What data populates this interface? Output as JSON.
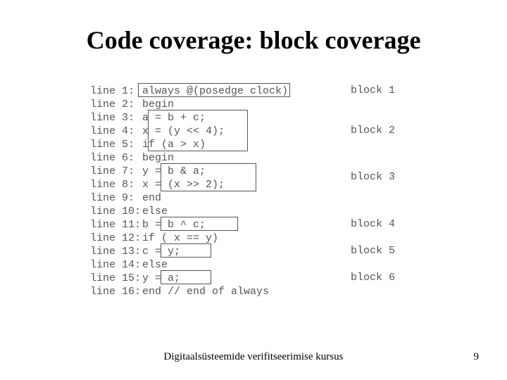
{
  "title": "Code coverage: block coverage",
  "lines": [
    {
      "n": "line 1:",
      "code": "always @(posedge clock)"
    },
    {
      "n": "line 2:",
      "code": "begin"
    },
    {
      "n": "line 3:",
      "code": "  a = b + c;"
    },
    {
      "n": "line 4:",
      "code": "  x = (y << 4);"
    },
    {
      "n": "line 5:",
      "code": "  if (a > x)"
    },
    {
      "n": "line 6:",
      "code": "  begin"
    },
    {
      "n": "line 7:",
      "code": "    y = b & a;"
    },
    {
      "n": "line 8:",
      "code": "    x = (x >> 2);"
    },
    {
      "n": "line 9:",
      "code": "  end"
    },
    {
      "n": "line 10:",
      "code": "  else"
    },
    {
      "n": "line 11:",
      "code": "    b = b ^ c;"
    },
    {
      "n": "line 12:",
      "code": "  if ( x == y)"
    },
    {
      "n": "line 13:",
      "code": "    c = y;"
    },
    {
      "n": "line 14:",
      "code": "  else"
    },
    {
      "n": "line 15:",
      "code": "    y = a;"
    },
    {
      "n": "line 16:",
      "code": "end // end of always"
    }
  ],
  "blocks": {
    "b1": "block 1",
    "b2": "block 2",
    "b3": "block 3",
    "b4": "block 4",
    "b5": "block 5",
    "b6": "block 6"
  },
  "footer": "Digitaalsüsteemide verifitseerimise kursus",
  "page": "9"
}
